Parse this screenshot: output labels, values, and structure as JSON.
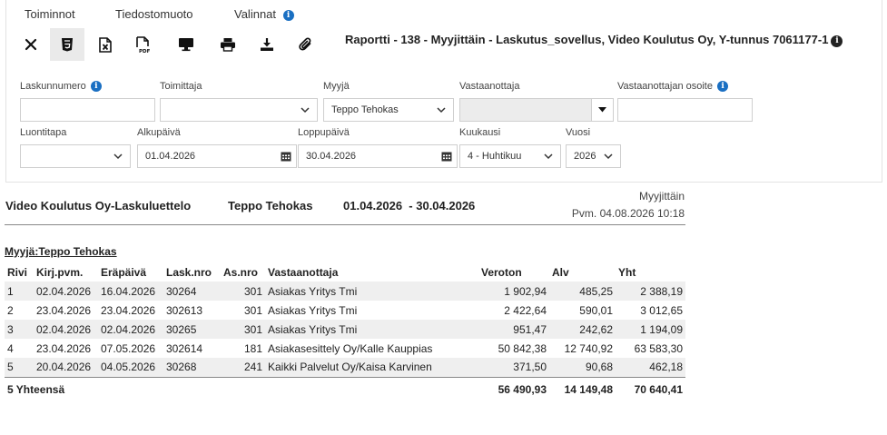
{
  "menu": {
    "actions": "Toiminnot",
    "file_format": "Tiedostomuoto",
    "options": "Valinnat"
  },
  "toolbar": {
    "buttons": [
      {
        "icon": "close-icon"
      },
      {
        "icon": "html5-icon",
        "active": true
      },
      {
        "icon": "excel-icon"
      },
      {
        "icon": "pdf-icon"
      },
      {
        "icon": "monitor-icon"
      },
      {
        "icon": "printer-icon"
      },
      {
        "icon": "download-icon"
      },
      {
        "icon": "paperclip-icon"
      }
    ],
    "report_title": "Raportti - 138 - Myyjittäin - Laskutus_sovellus, Video Koulutus Oy, Y-tunnus 7061177-1"
  },
  "filters": {
    "invoice_number": {
      "label": "Laskunnumero",
      "value": ""
    },
    "supplier": {
      "label": "Toimittaja",
      "value": ""
    },
    "seller": {
      "label": "Myyjä",
      "value": "Teppo Tehokas"
    },
    "recipient": {
      "label": "Vastaanottaja",
      "value": ""
    },
    "recipient_address": {
      "label": "Vastaanottajan osoite",
      "value": ""
    },
    "creation_method": {
      "label": "Luontitapa",
      "value": ""
    },
    "start_date": {
      "label": "Alkupäivä",
      "value": "01.04.2026"
    },
    "end_date": {
      "label": "Loppupäivä",
      "value": "30.04.2026"
    },
    "month": {
      "label": "Kuukausi",
      "value": "4 - Huhtikuu"
    },
    "year": {
      "label": "Vuosi",
      "value": "2026"
    }
  },
  "report": {
    "company": "Video Koulutus Oy-Laskuluettelo",
    "seller": "Teppo Tehokas",
    "date_range": "01.04.2026  - 30.04.2026",
    "type": "Myyjittäin",
    "printed": "Pvm. 04.08.2026 10:18",
    "section_heading": "Myyjä:Teppo Tehokas",
    "columns": [
      "Rivi",
      "Kirj.pvm.",
      "Eräpäivä",
      "Lask.nro",
      "As.nro",
      "Vastaanottaja",
      "Veroton",
      "Alv",
      "Yht"
    ],
    "rows": [
      [
        "1",
        "02.04.2026",
        "16.04.2026",
        "30264",
        "301",
        "Asiakas Yritys Tmi",
        "1 902,94",
        "485,25",
        "2 388,19"
      ],
      [
        "2",
        "23.04.2026",
        "23.04.2026",
        "302613",
        "301",
        "Asiakas Yritys Tmi",
        "2 422,64",
        "590,01",
        "3 012,65"
      ],
      [
        "3",
        "02.04.2026",
        "02.04.2026",
        "30265",
        "301",
        "Asiakas Yritys Tmi",
        "951,47",
        "242,62",
        "1 194,09"
      ],
      [
        "4",
        "23.04.2026",
        "07.05.2026",
        "302614",
        "181",
        "Asiakasesittely Oy/Kalle Kauppias",
        "50 842,38",
        "12 740,92",
        "63 583,30"
      ],
      [
        "5",
        "20.04.2026",
        "04.05.2026",
        "30268",
        "241",
        "Kaikki Palvelut Oy/Kaisa Karvinen",
        "371,50",
        "90,68",
        "462,18"
      ]
    ],
    "totals": {
      "label": "5 Yhteensä",
      "net": "56 490,93",
      "vat": "14 149,48",
      "total": "70 640,41"
    }
  }
}
